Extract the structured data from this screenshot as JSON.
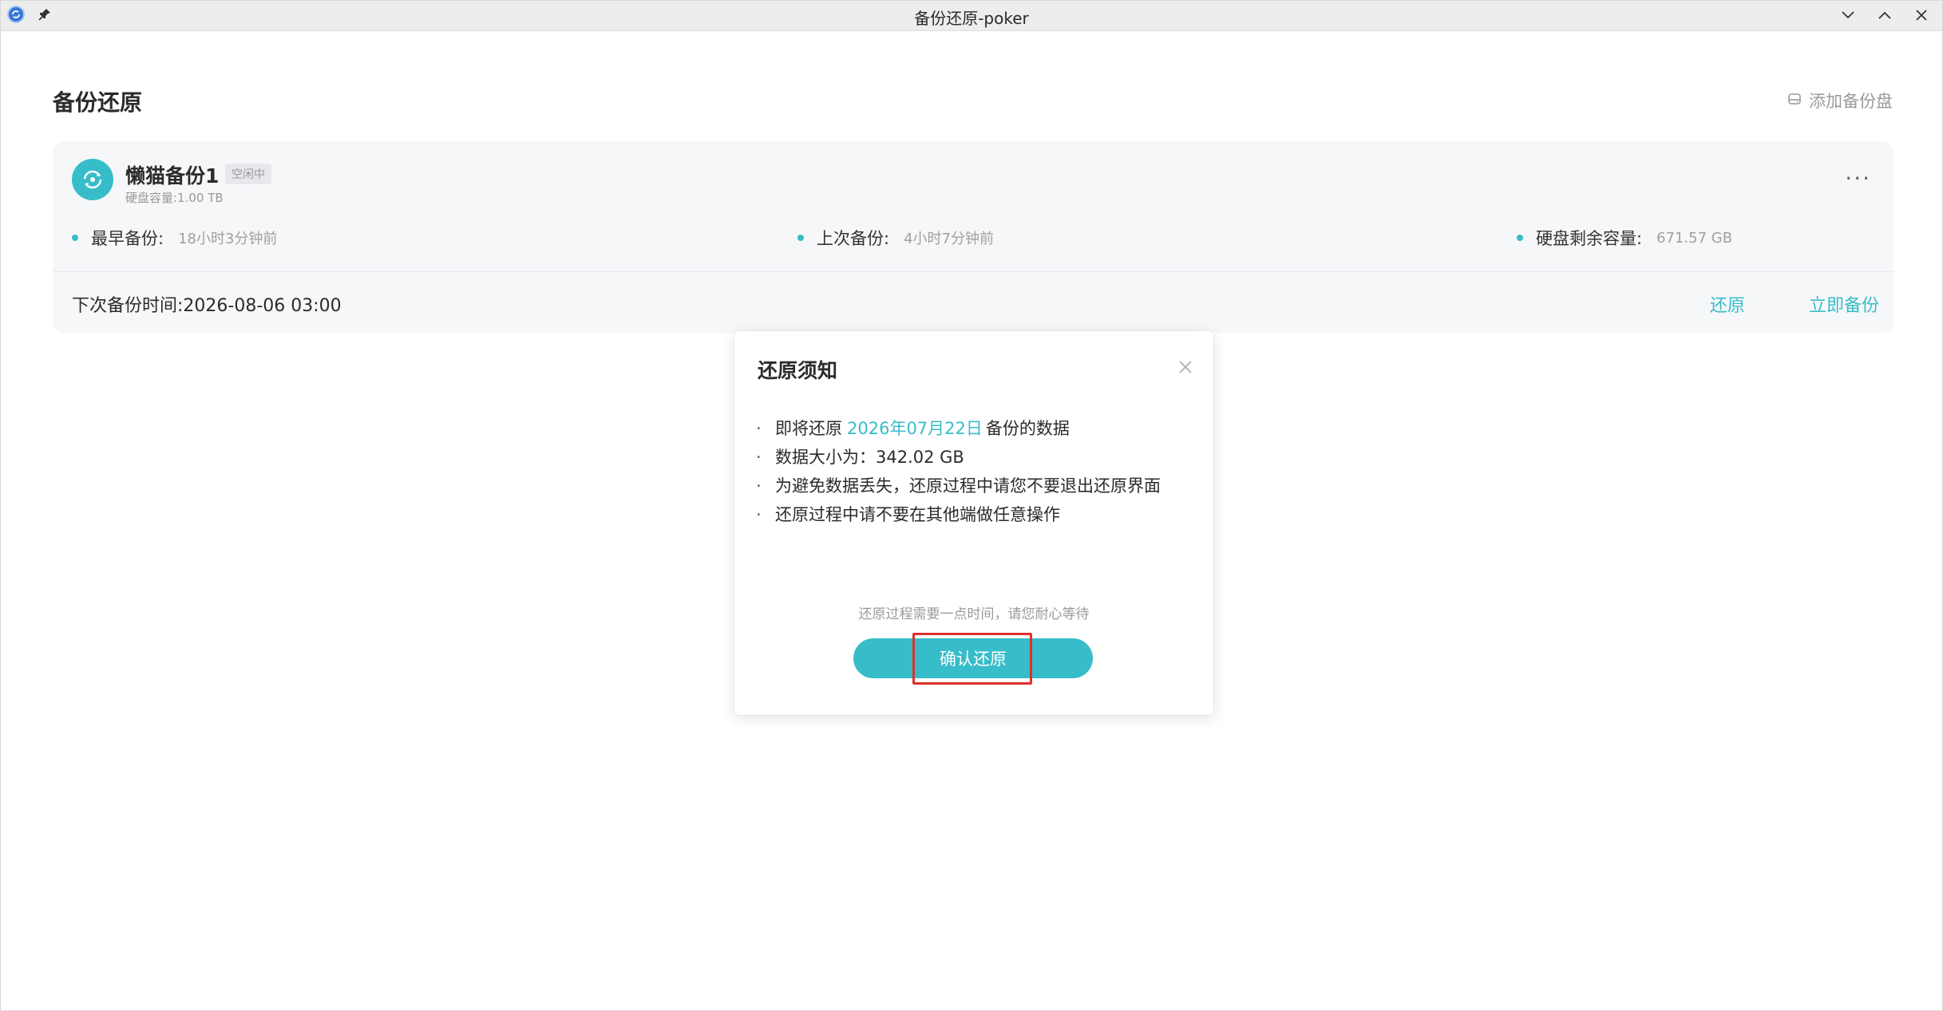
{
  "window": {
    "title": "备份还原-poker"
  },
  "page": {
    "title": "备份还原",
    "add_disk_label": "添加备份盘"
  },
  "card": {
    "name": "懒猫备份1",
    "status_badge": "空闲中",
    "capacity": "硬盘容量:1.00 TB",
    "more": "···",
    "stats": [
      {
        "label": "最早备份:",
        "value": "18小时3分钟前"
      },
      {
        "label": "上次备份:",
        "value": "4小时7分钟前"
      },
      {
        "label": "硬盘剩余容量:",
        "value": "671.57 GB"
      }
    ],
    "next_backup": "下次备份时间:2026-08-06 03:00",
    "restore_label": "还原",
    "backup_now_label": "立即备份"
  },
  "modal": {
    "title": "还原须知",
    "items": [
      {
        "prefix": "即将还原",
        "highlight": "2026年07月22日",
        "suffix": "备份的数据"
      },
      {
        "text": "数据大小为：342.02 GB"
      },
      {
        "text": "为避免数据丢失，还原过程中请您不要退出还原界面"
      },
      {
        "text": "还原过程中请不要在其他端做任意操作"
      }
    ],
    "hint": "还原过程需要一点时间，请您耐心等待",
    "confirm_label": "确认还原"
  },
  "colors": {
    "accent": "#36bdc9",
    "highlight_border": "#e0302b"
  },
  "icons": {
    "app": "app-icon",
    "pin": "pin-icon",
    "minimize": "chevron-down-icon",
    "maximize": "chevron-up-icon",
    "close": "close-icon",
    "disk": "disk-icon",
    "backup": "sync-icon"
  }
}
